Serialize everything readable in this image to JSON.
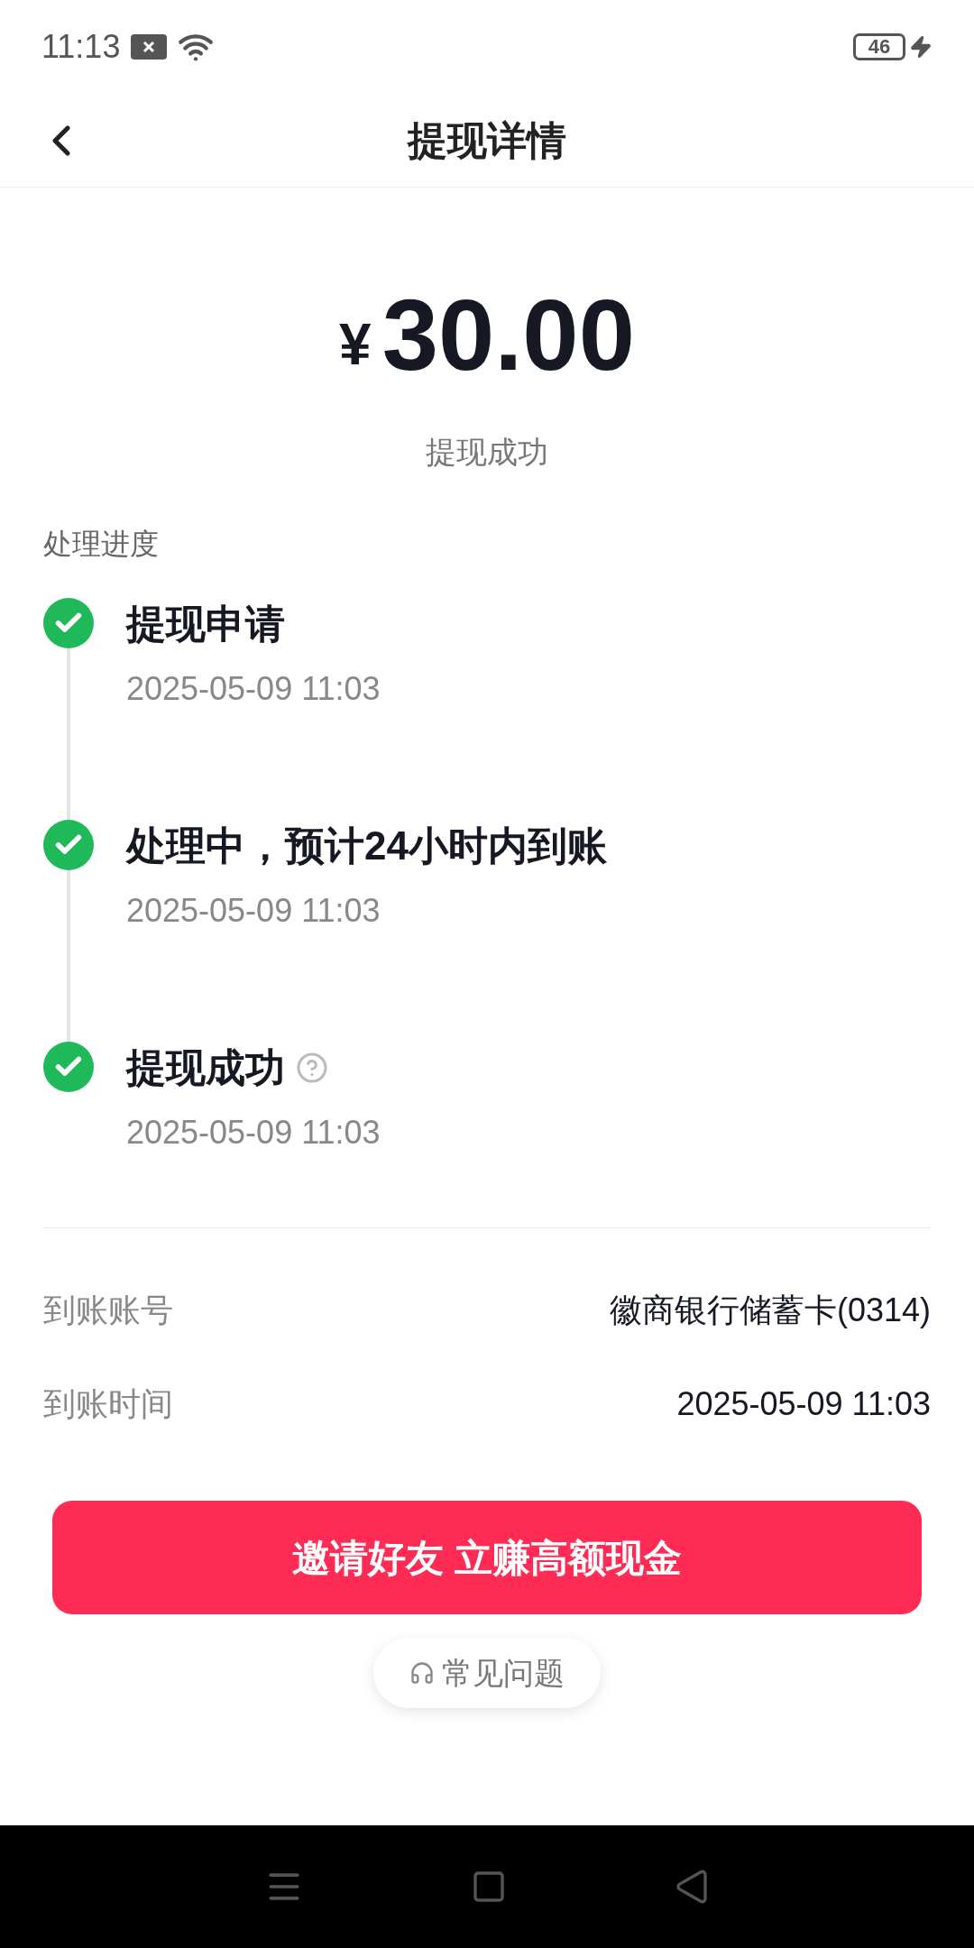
{
  "status_bar": {
    "time": "11:13",
    "battery": "46"
  },
  "header": {
    "title": "提现详情"
  },
  "amount": {
    "currency": "¥",
    "value": "30.00",
    "status": "提现成功"
  },
  "progress": {
    "title": "处理进度",
    "steps": [
      {
        "title": "提现申请",
        "time": "2025-05-09 11:03",
        "done": true,
        "help": false
      },
      {
        "title": "处理中，预计24小时内到账",
        "time": "2025-05-09 11:03",
        "done": true,
        "help": false
      },
      {
        "title": "提现成功",
        "time": "2025-05-09 11:03",
        "done": true,
        "help": true
      }
    ]
  },
  "details": [
    {
      "label": "到账账号",
      "value": "徽商银行储蓄卡(0314)"
    },
    {
      "label": "到账时间",
      "value": "2025-05-09 11:03"
    }
  ],
  "invite_button": "邀请好友 立赚高额现金",
  "faq_button": "常见问题"
}
